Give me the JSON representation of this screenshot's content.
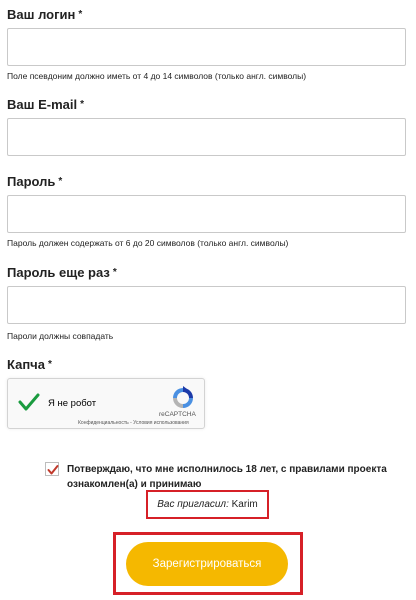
{
  "form": {
    "login": {
      "label": "Ваш логин",
      "required": "*",
      "hint": "Поле псевдоним должно иметь от 4 до 14 символов (только англ. символы)",
      "value": ""
    },
    "email": {
      "label": "Ваш E-mail",
      "required": "*",
      "value": ""
    },
    "password": {
      "label": "Пароль",
      "required": "*",
      "hint": "Пароль должен содержать от 6 до 20 символов (только англ. символы)",
      "value": ""
    },
    "password_repeat": {
      "label": "Пароль еще раз",
      "required": "*",
      "hint": "Пароли должны совпадать",
      "value": ""
    },
    "captcha": {
      "label": "Капча",
      "required": "*",
      "checkbox_text": "Я не робот",
      "checked": true,
      "brand": "reCAPTCHA",
      "links": "Конфиденциальность - Условия использования"
    },
    "agree": {
      "checked": true,
      "text": "Потверждаю, что мне исполнилось 18 лет, с правилами проекта ознакомлен(а) и принимаю"
    },
    "invited": {
      "prefix": "Вас пригласил:",
      "name": "Karim"
    },
    "submit_label": "Зарегистрироваться"
  },
  "colors": {
    "accent_button": "#f5b800",
    "highlight_frame": "#d62027",
    "captcha_check": "#1a9b3f",
    "agree_check": "#c0392b"
  }
}
